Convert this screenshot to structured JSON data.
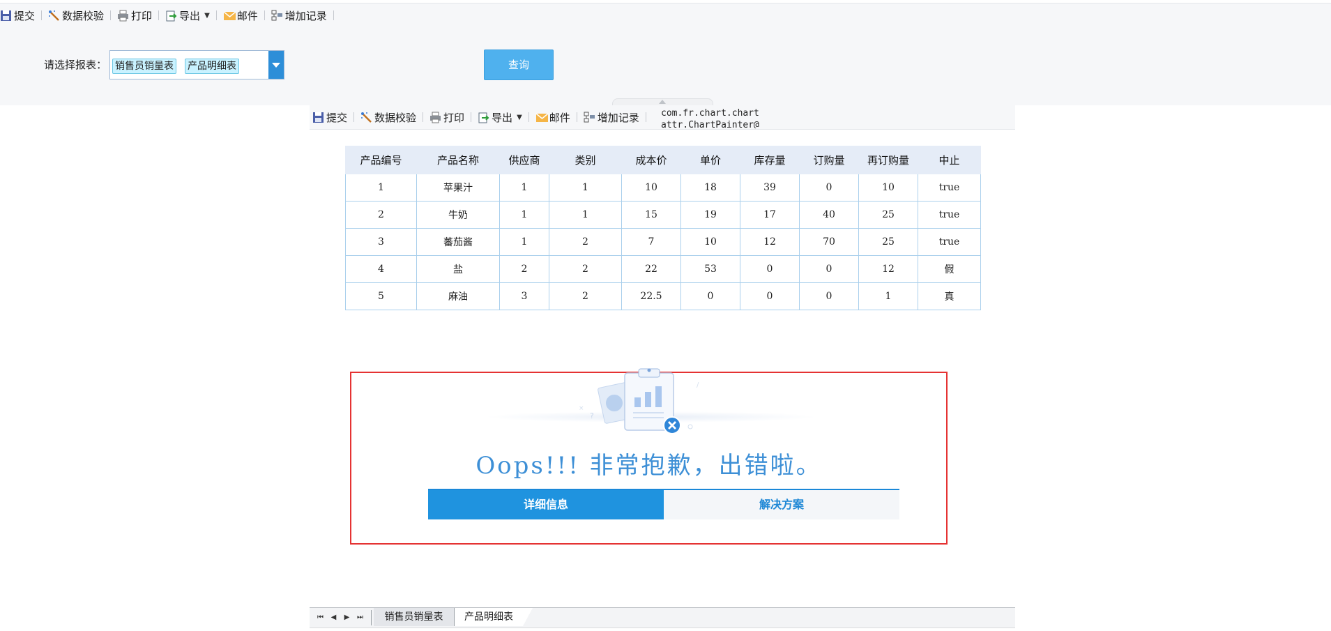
{
  "toolbar": {
    "items": [
      {
        "label": "提交",
        "icon": "save-icon"
      },
      {
        "label": "数据校验",
        "icon": "validate-wand-icon"
      },
      {
        "label": "打印",
        "icon": "printer-icon"
      },
      {
        "label": "导出",
        "icon": "export-icon"
      },
      {
        "label": "邮件",
        "icon": "mail-icon"
      },
      {
        "label": "增加记录",
        "icon": "add-record-icon"
      }
    ]
  },
  "filter": {
    "label": "请选择报表：",
    "selected": [
      "销售员销量表",
      "产品明细表"
    ],
    "query_button": "查询"
  },
  "inner_toolbar": {
    "debug_text_line1": "com.fr.chart.chart",
    "debug_text_line2": "attr.ChartPainter@"
  },
  "table": {
    "headers": [
      "产品编号",
      "产品名称",
      "供应商",
      "类别",
      "成本价",
      "单价",
      "库存量",
      "订购量",
      "再订购量",
      "中止"
    ],
    "rows": [
      [
        "1",
        "苹果汁",
        "1",
        "1",
        "10",
        "18",
        "39",
        "0",
        "10",
        "true"
      ],
      [
        "2",
        "牛奶",
        "1",
        "1",
        "15",
        "19",
        "17",
        "40",
        "25",
        "true"
      ],
      [
        "3",
        "蕃茄酱",
        "1",
        "2",
        "7",
        "10",
        "12",
        "70",
        "25",
        "true"
      ],
      [
        "4",
        "盐",
        "2",
        "2",
        "22",
        "53",
        "0",
        "0",
        "12",
        "假"
      ],
      [
        "5",
        "麻油",
        "3",
        "2",
        "22.5",
        "0",
        "0",
        "0",
        "1",
        "真"
      ]
    ]
  },
  "error": {
    "title": "Oops!!! 非常抱歉，出错啦。",
    "tabs": [
      "详细信息",
      "解决方案"
    ]
  },
  "sheets": {
    "nav": [
      "⏮",
      "◀",
      "▶",
      "⏭"
    ],
    "tabs": [
      "销售员销量表",
      "产品明细表"
    ]
  },
  "colors": {
    "accent": "#1f93df",
    "error_border": "#e53333",
    "query_button": "#4fb1ee"
  }
}
